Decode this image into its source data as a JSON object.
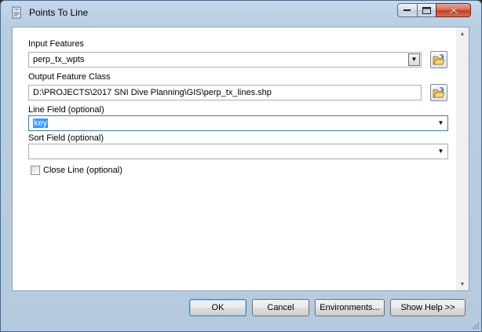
{
  "window": {
    "title": "Points To Line"
  },
  "form": {
    "input_features": {
      "label": "Input Features",
      "value": "perp_tx_wpts"
    },
    "output_feature_class": {
      "label": "Output Feature Class",
      "value": "D:\\PROJECTS\\2017 SNI Dive Planning\\GIS\\perp_tx_lines.shp"
    },
    "line_field": {
      "label": "Line Field (optional)",
      "value": "key"
    },
    "sort_field": {
      "label": "Sort Field (optional)",
      "value": ""
    },
    "close_line": {
      "label": "Close Line (optional)",
      "checked": false
    }
  },
  "buttons": {
    "ok": "OK",
    "cancel": "Cancel",
    "environments": "Environments...",
    "show_help": "Show Help >>"
  },
  "icons": {
    "app": "toolbox-script-icon",
    "folder": "open-folder-icon"
  },
  "colors": {
    "selection": "#3399ff",
    "close_button": "#c2402a",
    "title_bar": "#c5d8ec"
  }
}
